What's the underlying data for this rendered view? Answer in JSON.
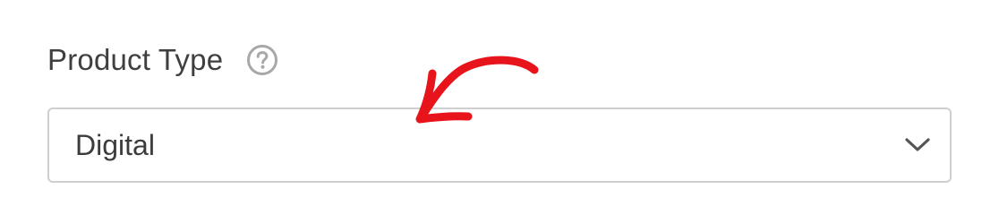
{
  "field": {
    "label": "Product Type",
    "help_icon": "question-circle-icon",
    "value": "Digital",
    "dropdown_icon": "chevron-down-icon"
  },
  "annotation": {
    "icon": "red-curved-arrow",
    "color": "#e8141c"
  },
  "colors": {
    "label_text": "#3f3f3f",
    "value_text": "#3c3c3c",
    "border": "#cfcfcf",
    "help_icon": "#a8a8a8",
    "chevron": "#555555"
  }
}
